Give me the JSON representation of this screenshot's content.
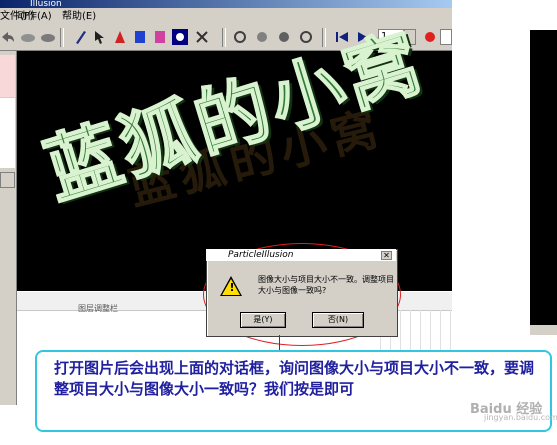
{
  "window": {
    "title": "Illusion"
  },
  "menu": {
    "items": [
      "文件(F)",
      "动作(A)",
      "帮助(E)"
    ]
  },
  "toolbar": {
    "frame_value": "1"
  },
  "bottom": {
    "panel_label": "图层调整栏"
  },
  "watermark": {
    "main": "蓝狐的小窝",
    "shadow": "蓝狐的小窝"
  },
  "dialog": {
    "title": "ParticleIllusion",
    "message": "图像大小与项目大小不一致。调整项目大小与图像一致吗?",
    "yes_label": "是(Y)",
    "no_label": "否(N)",
    "close_label": "✕"
  },
  "caption": {
    "text": "打开图片后会出现上面的对话框，询问图像大小与项目大小不一致，要调整项目大小与图像大小一致吗？我们按是即可"
  },
  "brand": {
    "logo": "Baidu 经验",
    "url": "jingyan.baidu.com"
  },
  "colors": {
    "accent_red": "#e02020",
    "caption_border": "#33c6e0",
    "caption_text": "#2020a0"
  }
}
